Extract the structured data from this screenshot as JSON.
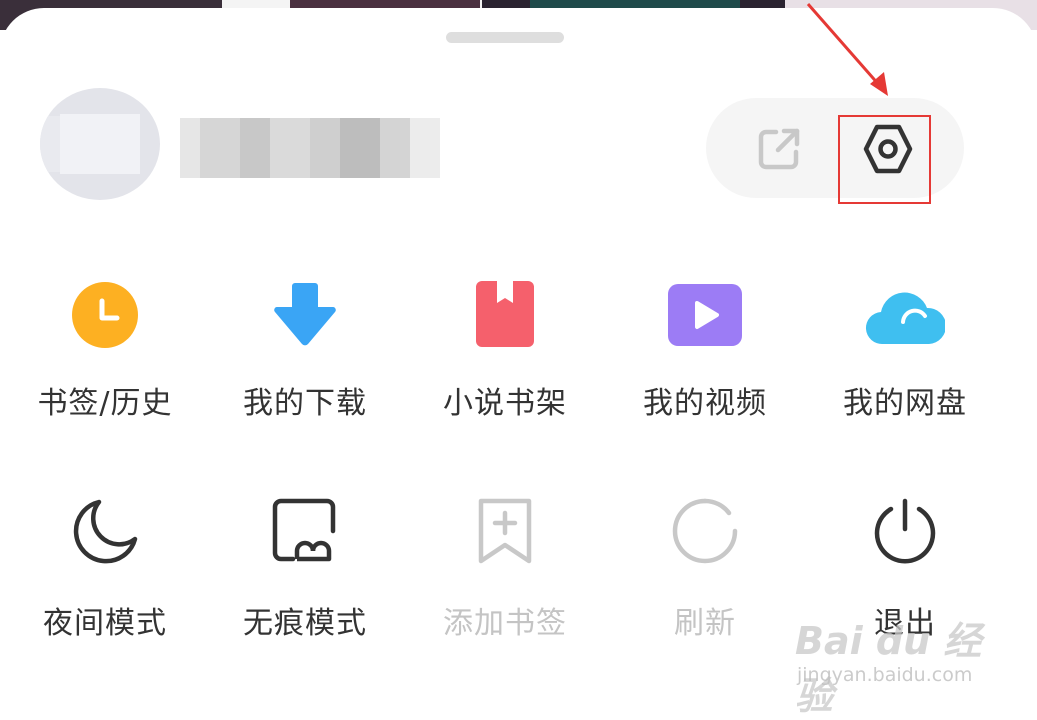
{
  "header": {
    "share_icon": "external-link-icon",
    "settings_icon": "hexagon-gear-icon",
    "accent_annotation_color": "#e53935"
  },
  "menu_rows": [
    [
      {
        "label": "书签/历史",
        "icon": "clock-icon",
        "color": "#fdb022"
      },
      {
        "label": "我的下载",
        "icon": "download-arrow-icon",
        "color": "#3aa5f5"
      },
      {
        "label": "小说书架",
        "icon": "bookmark-book-icon",
        "color": "#f5606c"
      },
      {
        "label": "我的视频",
        "icon": "play-video-icon",
        "color": "#9c7cf5"
      },
      {
        "label": "我的网盘",
        "icon": "cloud-icon",
        "color": "#3fbff0"
      }
    ],
    [
      {
        "label": "夜间模式",
        "icon": "moon-icon",
        "enabled": true
      },
      {
        "label": "无痕模式",
        "icon": "incognito-frame-icon",
        "enabled": true
      },
      {
        "label": "添加书签",
        "icon": "add-bookmark-icon",
        "enabled": false
      },
      {
        "label": "刷新",
        "icon": "refresh-icon",
        "enabled": false
      },
      {
        "label": "退出",
        "icon": "power-icon",
        "enabled": true
      }
    ]
  ],
  "watermark": {
    "brand": "Bai du 经验",
    "url": "jingyan.baidu.com"
  }
}
